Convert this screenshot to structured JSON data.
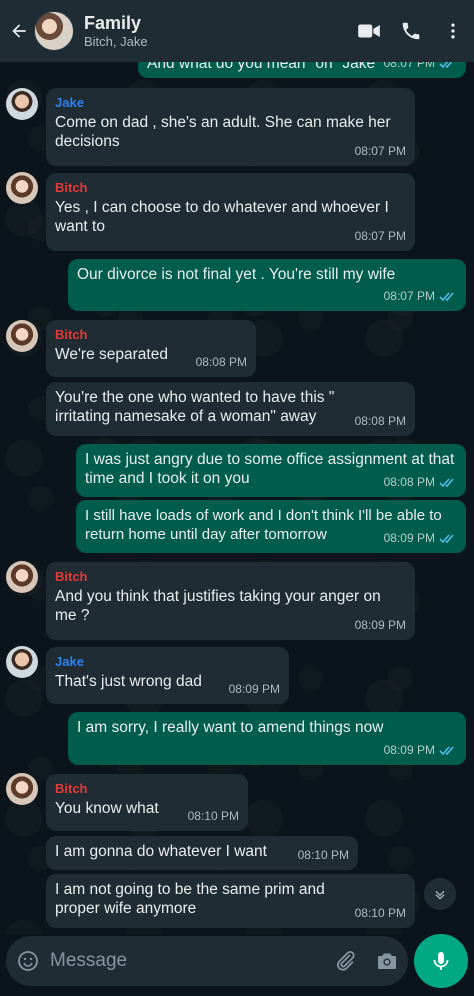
{
  "header": {
    "title": "Family",
    "subtitle": "Bitch, Jake"
  },
  "colors": {
    "jake": "#2f80ed",
    "bitch": "#e53935",
    "outgoing_bubble": "#005c4b",
    "incoming_bubble": "#1f2c34",
    "read_ticks": "#53bdeb",
    "accent": "#00a884"
  },
  "messages": [
    {
      "dir": "out",
      "text": "And what do you mean \"on\" Jake",
      "time": "08:07 PM"
    },
    {
      "dir": "in",
      "sender": "Jake",
      "text": "Come on dad , she's an adult. She can make her decisions",
      "time": "08:07 PM"
    },
    {
      "dir": "in",
      "sender": "Bitch",
      "text": "Yes , I can choose to do whatever and whoever I want to",
      "time": "08:07 PM"
    },
    {
      "dir": "out",
      "text": "Our divorce is not final yet . You're still my wife",
      "time": "08:07 PM"
    },
    {
      "dir": "in",
      "sender": "Bitch",
      "text": "We're separated",
      "time": "08:08 PM"
    },
    {
      "dir": "in",
      "text": "You're the one who wanted to have this \" irritating namesake of a woman\" away",
      "time": "08:08 PM"
    },
    {
      "dir": "out",
      "text": "I was just angry due to some office assignment at that time and I took it on you",
      "time": "08:08 PM"
    },
    {
      "dir": "out",
      "text": "I still have loads of work and I don't think I'll be able to return home until day after tomorrow",
      "time": "08:09 PM"
    },
    {
      "dir": "in",
      "sender": "Bitch",
      "text": "And you think that justifies taking your anger on me ?",
      "time": "08:09 PM"
    },
    {
      "dir": "in",
      "sender": "Jake",
      "text": "That's just wrong dad",
      "time": "08:09 PM"
    },
    {
      "dir": "out",
      "text": "I am sorry, I really want to amend things now",
      "time": "08:09 PM"
    },
    {
      "dir": "in",
      "sender": "Bitch",
      "text": "You know what",
      "time": "08:10 PM"
    },
    {
      "dir": "in",
      "text": "I am gonna do whatever I want",
      "time": "08:10 PM"
    },
    {
      "dir": "in",
      "text": "I am not going to be the same prim and proper wife anymore",
      "time": "08:10 PM"
    }
  ],
  "composer": {
    "placeholder": "Message"
  },
  "icons": {
    "back": "arrow-left-icon",
    "video": "video-call-icon",
    "call": "phone-icon",
    "menu": "more-vert-icon",
    "emoji": "emoji-icon",
    "attach": "paperclip-icon",
    "camera": "camera-icon",
    "mic": "mic-icon",
    "scroll": "chevron-down-icon"
  }
}
